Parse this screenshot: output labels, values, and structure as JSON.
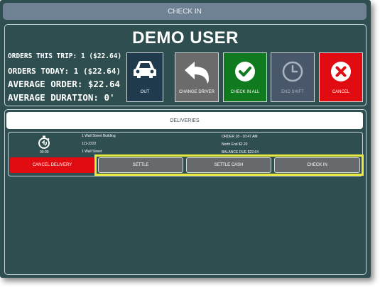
{
  "topbar": {
    "title": "CHECK IN"
  },
  "driver": {
    "name": "DEMO USER"
  },
  "stats": {
    "trip": "ORDERS THIS TRIP:  1 ($22.64)",
    "today": "ORDERS TODAY:  1 ($22.64)",
    "avg_order": "AVERAGE ORDER:  $22.64",
    "avg_duration": "AVERAGE DURATION:   0'"
  },
  "actions": {
    "out": "OUT",
    "change_driver": "CHANGE DRIVER",
    "check_in_all": "CHECK IN ALL",
    "end_shift": "END SHIFT",
    "cancel": "CANCEL"
  },
  "deliveries": {
    "header": "DELIVERIES",
    "item": {
      "timer": "00:00",
      "address1": "1 Wall Street Building",
      "phone": "111-2222",
      "address2": "1 Wall Street",
      "order": "ORDER 18  -  10:47 AM",
      "area": "North End $2.20",
      "balance": "BALANCE DUE $22.64"
    },
    "buttons": {
      "cancel_delivery": "CANCEL DELIVERY",
      "settle": "SETTLE",
      "settle_cash": "SETTLE CASH",
      "check_in": "CHECK IN"
    }
  },
  "colors": {
    "background": "#2f4e4f",
    "out": "#1f3b4d",
    "change_driver": "#6b6b6b",
    "check_in_all": "#0f7a1e",
    "end_shift": "#48576a",
    "cancel": "#e10b12",
    "highlight": "#ecea3a"
  }
}
